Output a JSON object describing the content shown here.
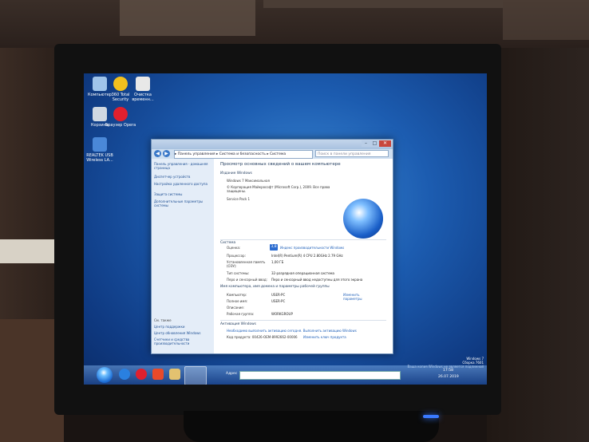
{
  "desktop": {
    "icons": [
      {
        "label": "Компьютер",
        "color": "#9fc4ea"
      },
      {
        "label": "360 Total Security",
        "color": "#f2c01e"
      },
      {
        "label": "Очистка временн...",
        "color": "#e8e8e8"
      },
      {
        "label": "Корзина",
        "color": "#cfd8e2"
      },
      {
        "label": "Браузер Opera",
        "color": "#e0202e"
      },
      {
        "label": "REALTEK USB Wireless LA...",
        "color": "#4a88d8"
      }
    ]
  },
  "window": {
    "breadcrumb": "▸ Панель управления ▸ Система и безопасность ▸ Система",
    "search_placeholder": "Поиск в панели управления",
    "sidebar": {
      "home": "Панель управления - домашняя страница",
      "items": [
        "Диспетчер устройств",
        "Настройка удаленного доступа",
        "Защита системы",
        "Дополнительные параметры системы"
      ],
      "see_also": "См. также",
      "see_also_items": [
        "Центр поддержки",
        "Центр обновления Windows",
        "Счетчики и средства производительности"
      ]
    },
    "main": {
      "title": "Просмотр основных сведений о вашем компьютере",
      "edition_header": "Издание Windows",
      "edition": "Windows 7 Максимальная",
      "copyright": "© Корпорация Майкрософт (Microsoft Corp.), 2009. Все права защищены.",
      "service_pack": "Service Pack 1",
      "system_header": "Система",
      "rows": [
        {
          "label": "Оценка:",
          "value": "Индекс производительности Windows"
        },
        {
          "label": "Процессор:",
          "value": "Intel(R) Pentium(R) 4 CPU 2.80GHz 2.79 GHz"
        },
        {
          "label": "Установленная память (ОЗУ):",
          "value": "1,00 ГБ"
        },
        {
          "label": "Тип системы:",
          "value": "32-разрядная операционная система"
        },
        {
          "label": "Перо и сенсорный ввод:",
          "value": "Перо и сенсорный ввод недоступны для этого экрана"
        }
      ],
      "perf_score": "3,8",
      "name_header": "Имя компьютера, имя домена и параметры рабочей группы",
      "name_rows": [
        {
          "label": "Компьютер:",
          "value": "USER-PC"
        },
        {
          "label": "Полное имя:",
          "value": "USER-PC"
        },
        {
          "label": "Описание:",
          "value": ""
        },
        {
          "label": "Рабочая группа:",
          "value": "WORKGROUP"
        }
      ],
      "change_params": "Изменить параметры",
      "activation_header": "Активация Windows",
      "activation_text": "Необходимо выполнить активацию сегодня. Выполнить активацию Windows",
      "product_id": "Код продукта: 00426-OEM-8992662-00006",
      "change_key": "Изменить ключ продукта"
    }
  },
  "taskbar": {
    "address_label": "Адрес",
    "time": "17:58",
    "date": "26.07.2019"
  },
  "watermark": {
    "line1": "Windows 7",
    "line2": "Сборка 7601",
    "line3": "Ваша копия Windows не является подлинной"
  }
}
